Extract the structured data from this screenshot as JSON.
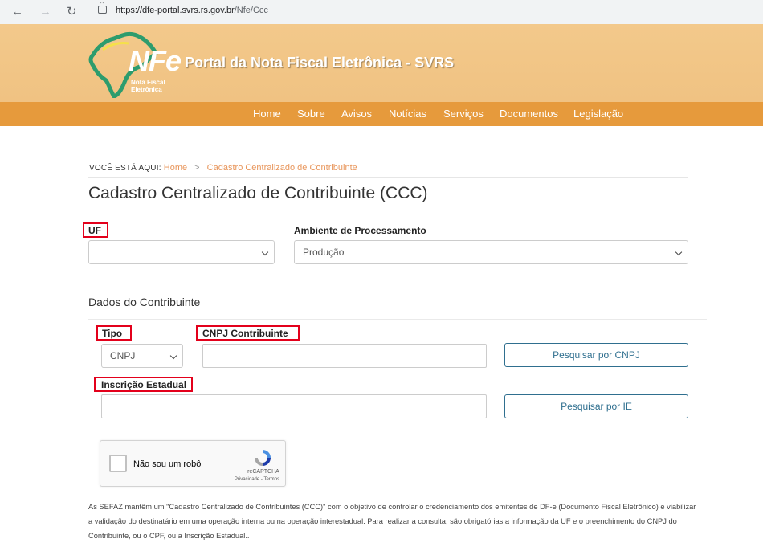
{
  "browser": {
    "url_domain": "https://dfe-portal.svrs.rs.gov.br",
    "url_path": "/Nfe/Ccc"
  },
  "header": {
    "logo_text": "NFe",
    "logo_sub": "Nota Fiscal\nEletrônica",
    "portal_title": "Portal da Nota Fiscal Eletrônica - SVRS",
    "colors": {
      "header_bg": "#f0c282",
      "menu_bg": "#e69a3c"
    }
  },
  "menu": {
    "items": [
      "Home",
      "Sobre",
      "Avisos",
      "Notícias",
      "Serviços",
      "Documentos",
      "Legislação"
    ]
  },
  "breadcrumb": {
    "label": "VOCÊ ESTÁ AQUI:",
    "home": "Home",
    "separator": ">",
    "current": "Cadastro Centralizado de Contribuinte"
  },
  "page": {
    "title": "Cadastro Centralizado de Contribuinte (CCC)"
  },
  "form": {
    "uf_label": "UF",
    "uf_value": "",
    "ambiente_label": "Ambiente de Processamento",
    "ambiente_value": "Produção",
    "section_title": "Dados do Contribuinte",
    "tipo_label": "Tipo",
    "tipo_value": "CNPJ",
    "cnpj_label": "CNPJ Contribuinte",
    "cnpj_value": "",
    "btn_cnpj": "Pesquisar por CNPJ",
    "ie_label": "Inscrição Estadual",
    "ie_value": "",
    "btn_ie": "Pesquisar por IE"
  },
  "captcha": {
    "label": "Não sou um robô",
    "brand": "reCAPTCHA",
    "terms": "Privacidade - Termos"
  },
  "description": "As SEFAZ mantêm um \"Cadastro Centralizado de Contribuintes (CCC)\" com o objetivo de controlar o credenciamento dos emitentes de DF-e (Documento Fiscal Eletrônico) e viabilizar a validação do destinatário em uma operação interna ou na operação interestadual. Para realizar a consulta, são obrigatórias a informação da UF e o preenchimento do CNPJ do Contribuinte, ou o CPF, ou a Inscrição Estadual.."
}
